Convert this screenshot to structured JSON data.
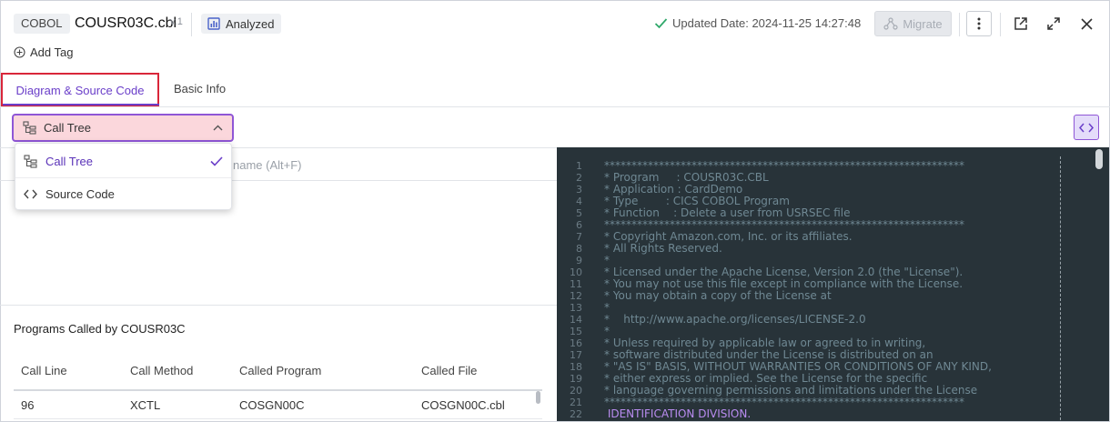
{
  "header": {
    "language": "COBOL",
    "file_name": "COUSR03C.cbl",
    "version": "v.1",
    "status": "Analyzed",
    "updated_label": "Updated Date: 2024-11-25 14:27:48",
    "migrate_label": "Migrate",
    "add_tag_label": "Add Tag",
    "check_color": "#2fa86a"
  },
  "tabs": [
    {
      "label": "Diagram & Source Code",
      "active": true
    },
    {
      "label": "Basic Info",
      "active": false
    }
  ],
  "view_select": {
    "selected": "Call Tree",
    "options": [
      "Call Tree",
      "Source Code"
    ]
  },
  "left_panel": {
    "search_placeholder_tail": "name (Alt+F)",
    "programs_title": "Programs Called by COUSR03C",
    "columns": [
      "Call Line",
      "Call Method",
      "Called Program",
      "Called File"
    ],
    "rows": [
      [
        "96",
        "XCTL",
        "COSGN00C",
        "COSGN00C.cbl"
      ]
    ]
  },
  "code": {
    "lines": [
      {
        "n": "1",
        "text": "******************************************************************"
      },
      {
        "n": "2",
        "text": "* Program     : COUSR03C.CBL"
      },
      {
        "n": "3",
        "text": "* Application : CardDemo"
      },
      {
        "n": "4",
        "text": "* Type        : CICS COBOL Program"
      },
      {
        "n": "5",
        "text": "* Function    : Delete a user from USRSEC file"
      },
      {
        "n": "6",
        "text": "******************************************************************"
      },
      {
        "n": "7",
        "text": "* Copyright Amazon.com, Inc. or its affiliates."
      },
      {
        "n": "8",
        "text": "* All Rights Reserved."
      },
      {
        "n": "9",
        "text": "*"
      },
      {
        "n": "10",
        "text": "* Licensed under the Apache License, Version 2.0 (the \"License\")."
      },
      {
        "n": "11",
        "text": "* You may not use this file except in compliance with the License."
      },
      {
        "n": "12",
        "text": "* You may obtain a copy of the License at"
      },
      {
        "n": "13",
        "text": "*"
      },
      {
        "n": "14",
        "text": "*    http://www.apache.org/licenses/LICENSE-2.0"
      },
      {
        "n": "15",
        "text": "*"
      },
      {
        "n": "16",
        "text": "* Unless required by applicable law or agreed to in writing,"
      },
      {
        "n": "17",
        "text": "* software distributed under the License is distributed on an"
      },
      {
        "n": "18",
        "text": "* \"AS IS\" BASIS, WITHOUT WARRANTIES OR CONDITIONS OF ANY KIND,"
      },
      {
        "n": "19",
        "text": "* either express or implied. See the License for the specific"
      },
      {
        "n": "20",
        "text": "* language governing permissions and limitations under the License"
      },
      {
        "n": "21",
        "text": "******************************************************************"
      },
      {
        "n": "22",
        "text": " IDENTIFICATION DIVISION.",
        "kw": true
      }
    ]
  }
}
